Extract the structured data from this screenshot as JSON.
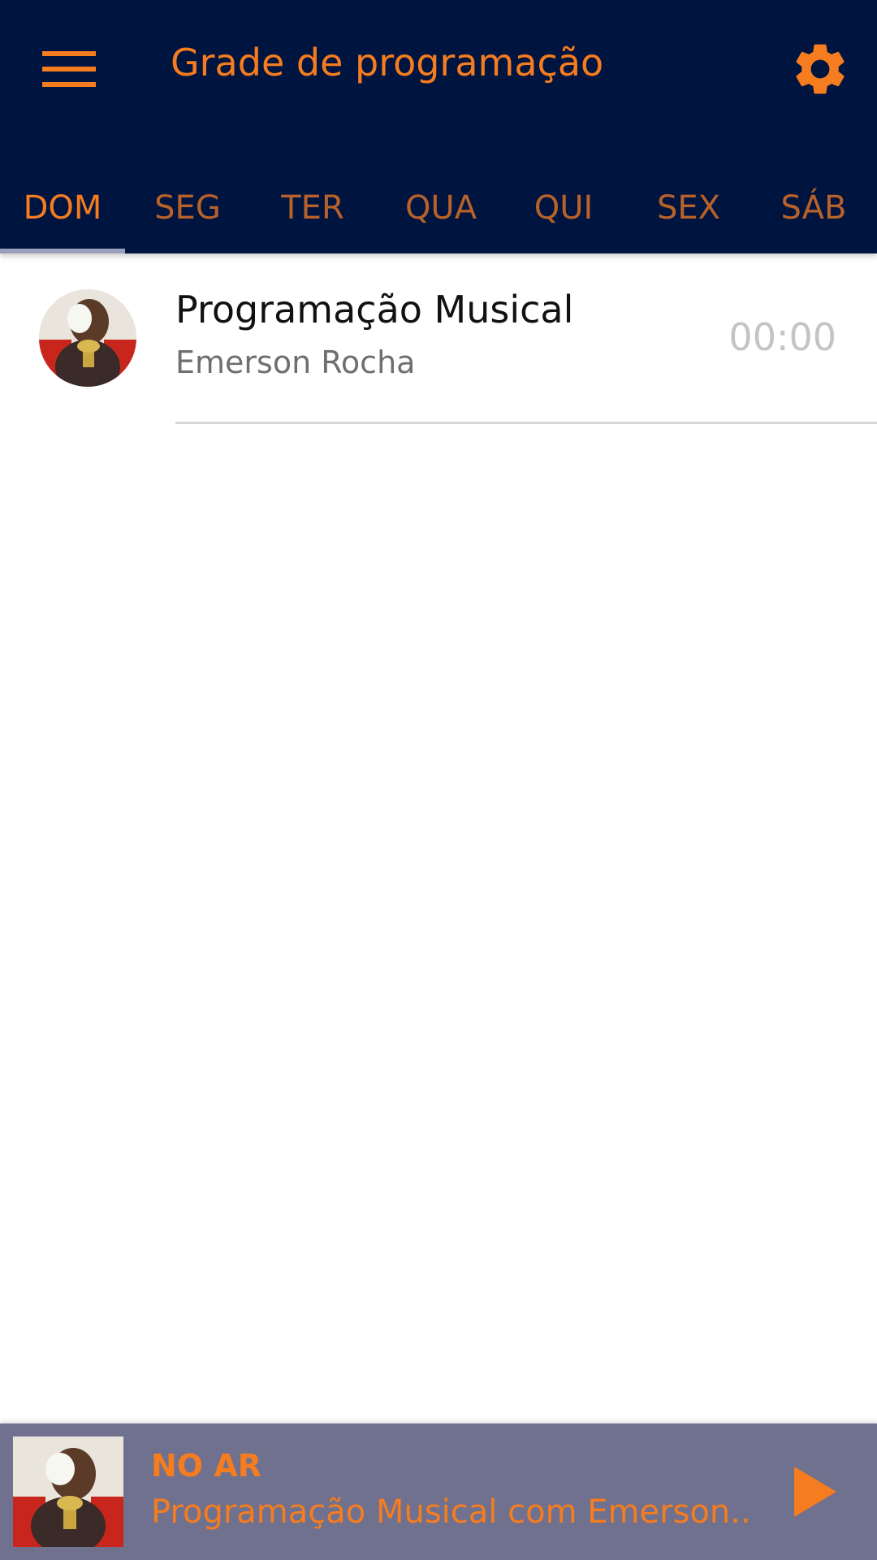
{
  "header": {
    "title": "Grade de programação",
    "menu_icon": "hamburger-menu-icon",
    "settings_icon": "gear-icon"
  },
  "tabs": [
    {
      "label": "DOM",
      "active": true
    },
    {
      "label": "SEG",
      "active": false
    },
    {
      "label": "TER",
      "active": false
    },
    {
      "label": "QUA",
      "active": false
    },
    {
      "label": "QUI",
      "active": false
    },
    {
      "label": "SEX",
      "active": false
    },
    {
      "label": "SÁB",
      "active": false
    }
  ],
  "schedule": [
    {
      "title": "Programação Musical",
      "host": "Emerson Rocha",
      "time": "00:00",
      "avatar_icon": "priest-avatar"
    }
  ],
  "player": {
    "status": "NO AR",
    "track": "Programação Musical com Emerson..",
    "play_icon": "play-icon"
  },
  "colors": {
    "header_bg": "#001440",
    "accent": "#f57c1f",
    "player_bg": "#70718f",
    "divider": "#d6d6d6"
  }
}
